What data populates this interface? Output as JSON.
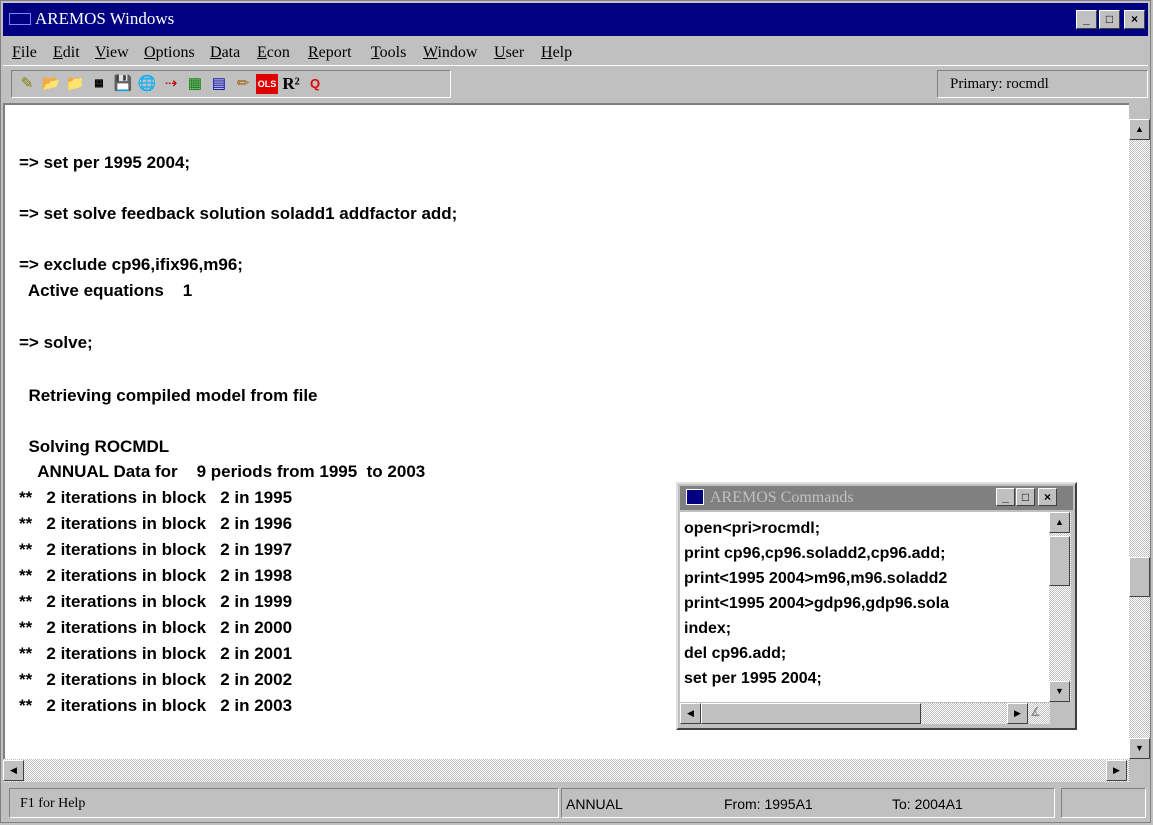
{
  "window": {
    "title": "AREMOS Windows",
    "min": "_",
    "max": "□",
    "close": "×"
  },
  "menu": [
    "File",
    "Edit",
    "View",
    "Options",
    "Data",
    "Econ",
    "Report",
    "Tools",
    "Window",
    "User",
    "Help"
  ],
  "toolbar": {
    "ols": "OLS",
    "r2": "R²",
    "q": "Q",
    "primary": "Primary: rocmdl"
  },
  "console": {
    "lines": [
      "=> set per 1995 2004;",
      "=> set solve feedback solution soladd1 addfactor add;",
      "=> exclude cp96,ifix96,m96;",
      "  Active equations    1",
      "=> solve;",
      "  Retrieving compiled model from file",
      "  Solving ROCMDL",
      "    ANNUAL Data for    9 periods from 1995  to 2003",
      "**   2 iterations in block   2 in 1995",
      "**   2 iterations in block   2 in 1996",
      "**   2 iterations in block   2 in 1997",
      "**   2 iterations in block   2 in 1998",
      "**   2 iterations in block   2 in 1999",
      "**   2 iterations in block   2 in 2000",
      "**   2 iterations in block   2 in 2001",
      "**   2 iterations in block   2 in 2002",
      "**   2 iterations in block   2 in 2003"
    ]
  },
  "status": {
    "help": "F1 for Help",
    "freq": "ANNUAL",
    "from": "From:  1995A1",
    "to": "To:  2004A1"
  },
  "commands": {
    "title": "AREMOS Commands",
    "lines": [
      "open<pri>rocmdl;",
      "print cp96,cp96.soladd2,cp96.add;",
      "print<1995 2004>m96,m96.soladd2",
      "print<1995 2004>gdp96,gdp96.sola",
      "index;",
      "del cp96.add;",
      "set per 1995 2004;"
    ]
  },
  "icons": [
    "app-icon",
    "new-icon",
    "open-icon",
    "folder-icon",
    "series-icon",
    "save-icon",
    "globe-icon",
    "chart-icon",
    "table-icon",
    "graph-icon",
    "edit-icon"
  ]
}
